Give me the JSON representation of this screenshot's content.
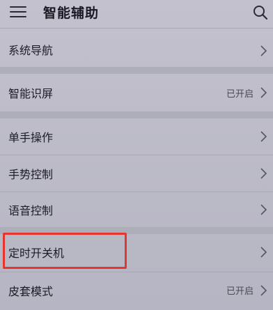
{
  "header": {
    "title": "智能辅助",
    "menu_icon": "hamburger-menu-icon",
    "search_icon": "search-icon"
  },
  "settings": [
    {
      "label": "系统导航",
      "status": ""
    },
    {
      "label": "智能识屏",
      "status": "已开启"
    },
    {
      "label": "单手操作",
      "status": ""
    },
    {
      "label": "手势控制",
      "status": ""
    },
    {
      "label": "语音控制",
      "status": ""
    },
    {
      "label": "定时开关机",
      "status": ""
    },
    {
      "label": "皮套模式",
      "status": "已开启"
    }
  ],
  "annotation": {
    "highlight_color": "#e8342f",
    "highlighted_item": "定时开关机"
  }
}
